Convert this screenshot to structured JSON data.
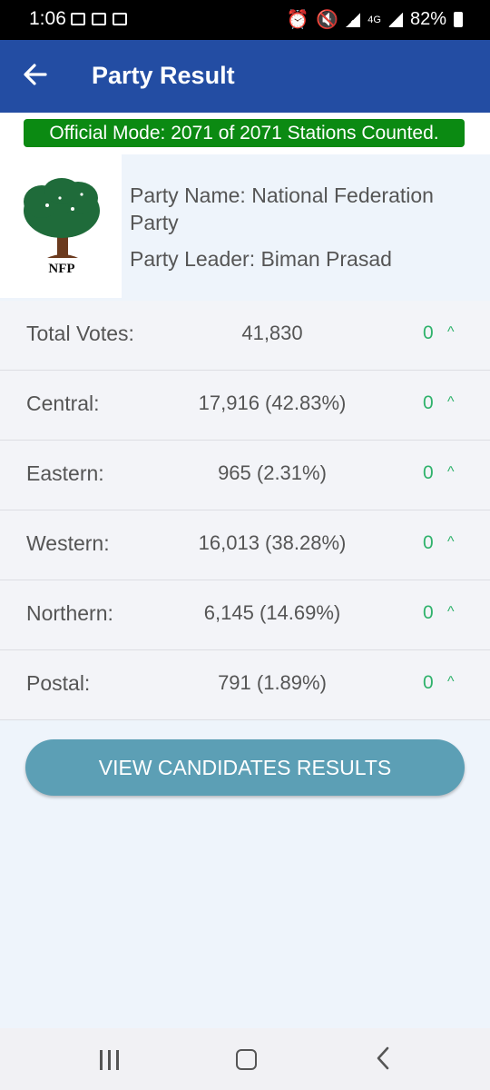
{
  "status_bar": {
    "time": "1:06",
    "network": "4G",
    "battery": "82%"
  },
  "app_bar": {
    "title": "Party Result",
    "back_icon": "back-arrow-icon"
  },
  "banner": {
    "text": "Official Mode: 2071 of 2071 Stations Counted.",
    "color": "#0b8a12"
  },
  "party": {
    "name": "Party Name: National Federation Party",
    "leader": "Party Leader: Biman Prasad",
    "logo_text": "NFP"
  },
  "rows": [
    {
      "label": "Total Votes:",
      "value": "41,830",
      "change": "0"
    },
    {
      "label": "Central:",
      "value": "17,916  (42.83%)",
      "change": "0"
    },
    {
      "label": "Eastern:",
      "value": "965  (2.31%)",
      "change": "0"
    },
    {
      "label": "Western:",
      "value": "16,013  (38.28%)",
      "change": "0"
    },
    {
      "label": "Northern:",
      "value": "6,145  (14.69%)",
      "change": "0"
    },
    {
      "label": "Postal:",
      "value": "791  (1.89%)",
      "change": "0"
    }
  ],
  "view_button": {
    "label": "VIEW CANDIDATES RESULTS"
  },
  "colors": {
    "app_bar": "#234da3",
    "button": "#5c9fb5",
    "change_up": "#2fb26b"
  }
}
